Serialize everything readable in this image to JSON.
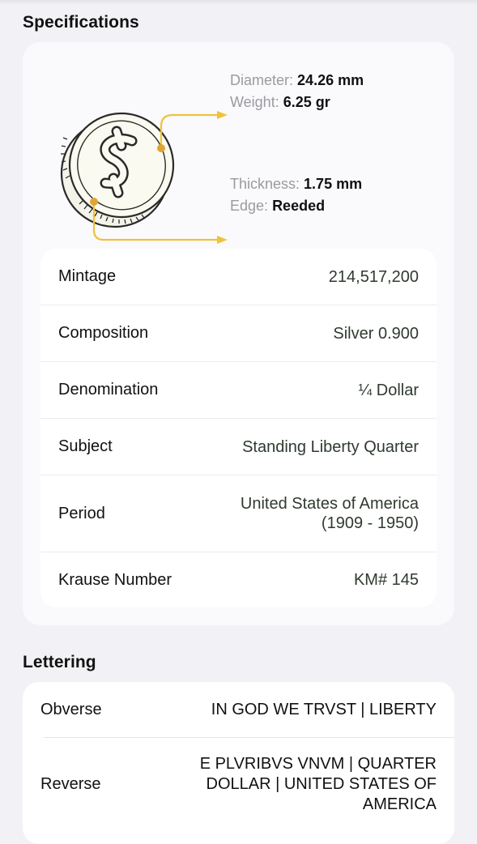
{
  "specifications": {
    "title": "Specifications",
    "dimensions": {
      "diameter": {
        "label": "Diameter:",
        "value": "24.26 mm"
      },
      "weight": {
        "label": "Weight:",
        "value": "6.25 gr"
      },
      "thickness": {
        "label": "Thickness:",
        "value": "1.75 mm"
      },
      "edge": {
        "label": "Edge:",
        "value": "Reeded"
      }
    },
    "coin_icon": "coin-dollar-icon",
    "rows": [
      {
        "key": "Mintage",
        "value": "214,517,200"
      },
      {
        "key": "Composition",
        "value": "Silver 0.900"
      },
      {
        "key": "Denomination",
        "value": "¼ Dollar"
      },
      {
        "key": "Subject",
        "value": "Standing Liberty Quarter"
      },
      {
        "key": "Period",
        "value": "United States of America (1909 - 1950)"
      },
      {
        "key": "Krause Number",
        "value": "KM# 145"
      }
    ]
  },
  "lettering": {
    "title": "Lettering",
    "rows": [
      {
        "key": "Obverse",
        "value": "IN GOD WE TRVST | LIBERTY"
      },
      {
        "key": "Reverse",
        "value": "E PLVRIBVS VNVM | QUARTER DOLLAR | UNITED STATES OF AMERICA"
      }
    ]
  },
  "colors": {
    "accent": "#f0c23a",
    "accent_dot": "#e0a536",
    "background": "#f2f2f6",
    "card": "#fafafc"
  }
}
